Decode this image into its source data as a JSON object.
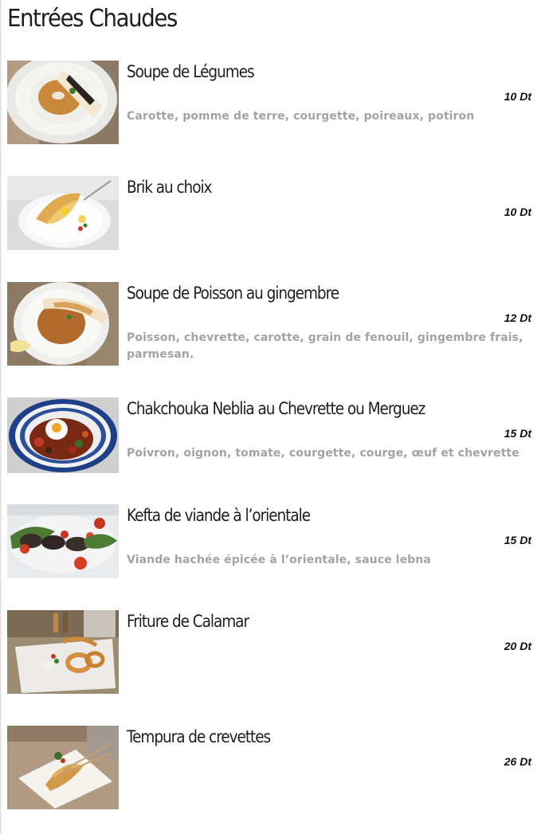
{
  "section": {
    "title": "Entrées Chaudes"
  },
  "items": [
    {
      "name": "Soupe de Légumes",
      "price": "10 Dt",
      "description": "Carotte, pomme de terre, courgette, poireaux, potiron"
    },
    {
      "name": "Brik au choix",
      "price": "10 Dt",
      "description": ""
    },
    {
      "name": "Soupe de Poisson au gingembre",
      "price": "12 Dt",
      "description": "Poisson, chevrette, carotte, grain de fenouil, gingembre frais, parmesan."
    },
    {
      "name": "Chakchouka Neblia au Chevrette ou Merguez",
      "price": "15 Dt",
      "description": "Poivron, oignon, tomate, courgette, courge, œuf et chevrette"
    },
    {
      "name": "Kefta de viande à l’orientale",
      "price": "15 Dt",
      "description": "Viande hachée épicée à l’orientale, sauce lebna"
    },
    {
      "name": "Friture de Calamar",
      "price": "20 Dt",
      "description": ""
    },
    {
      "name": "Tempura de crevettes",
      "price": "26 Dt",
      "description": ""
    }
  ]
}
